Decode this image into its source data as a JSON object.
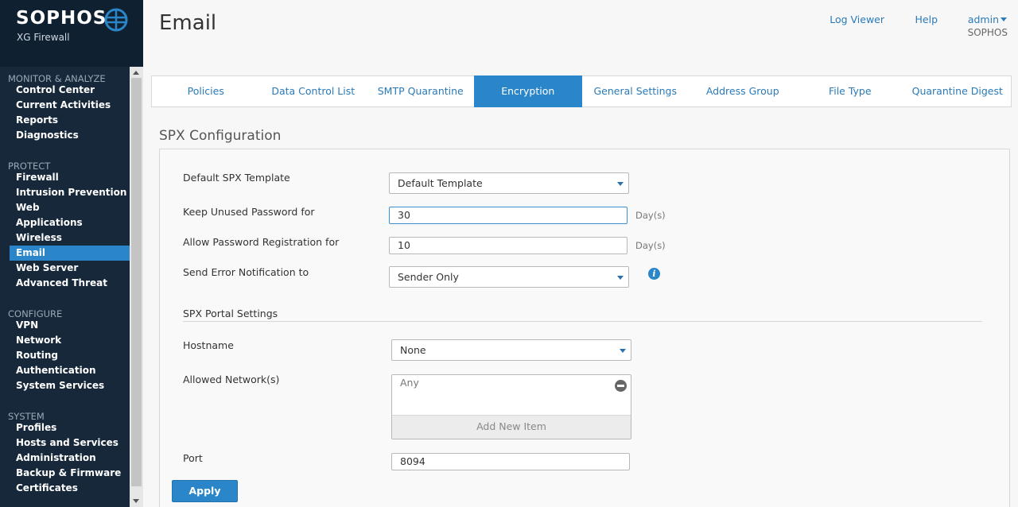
{
  "brand": {
    "name": "SOPHOS",
    "product": "XG Firewall"
  },
  "sidebar": {
    "groups": [
      {
        "title": "MONITOR & ANALYZE",
        "items": [
          "Control Center",
          "Current Activities",
          "Reports",
          "Diagnostics"
        ]
      },
      {
        "title": "PROTECT",
        "items": [
          "Firewall",
          "Intrusion Prevention",
          "Web",
          "Applications",
          "Wireless",
          "Email",
          "Web Server",
          "Advanced Threat"
        ]
      },
      {
        "title": "CONFIGURE",
        "items": [
          "VPN",
          "Network",
          "Routing",
          "Authentication",
          "System Services"
        ]
      },
      {
        "title": "SYSTEM",
        "items": [
          "Profiles",
          "Hosts and Services",
          "Administration",
          "Backup & Firmware",
          "Certificates"
        ]
      }
    ],
    "active_item": "Email"
  },
  "header": {
    "title": "Email",
    "links": {
      "log_viewer": "Log Viewer",
      "help": "Help",
      "user": "admin"
    },
    "org": "SOPHOS"
  },
  "tabs": [
    "Policies",
    "Data Control List",
    "SMTP Quarantine",
    "Encryption",
    "General Settings",
    "Address Group",
    "File Type",
    "Quarantine Digest"
  ],
  "active_tab": "Encryption",
  "spx": {
    "section_title": "SPX Configuration",
    "default_template": {
      "label": "Default SPX Template",
      "value": "Default Template"
    },
    "keep_unused": {
      "label": "Keep Unused Password for",
      "value": "30",
      "unit": "Day(s)"
    },
    "allow_registration": {
      "label": "Allow Password Registration for",
      "value": "10",
      "unit": "Day(s)"
    },
    "error_notification": {
      "label": "Send Error Notification to",
      "value": "Sender Only"
    },
    "portal": {
      "heading": "SPX Portal Settings",
      "hostname": {
        "label": "Hostname",
        "value": "None"
      },
      "allowed_networks": {
        "label": "Allowed Network(s)",
        "items": [
          "Any"
        ],
        "add_label": "Add New Item"
      },
      "port": {
        "label": "Port",
        "value": "8094"
      }
    },
    "apply_label": "Apply"
  },
  "colors": {
    "accent": "#2a86c9",
    "sidebar_bg": "#16283a",
    "brand_bg": "#0f2030"
  }
}
